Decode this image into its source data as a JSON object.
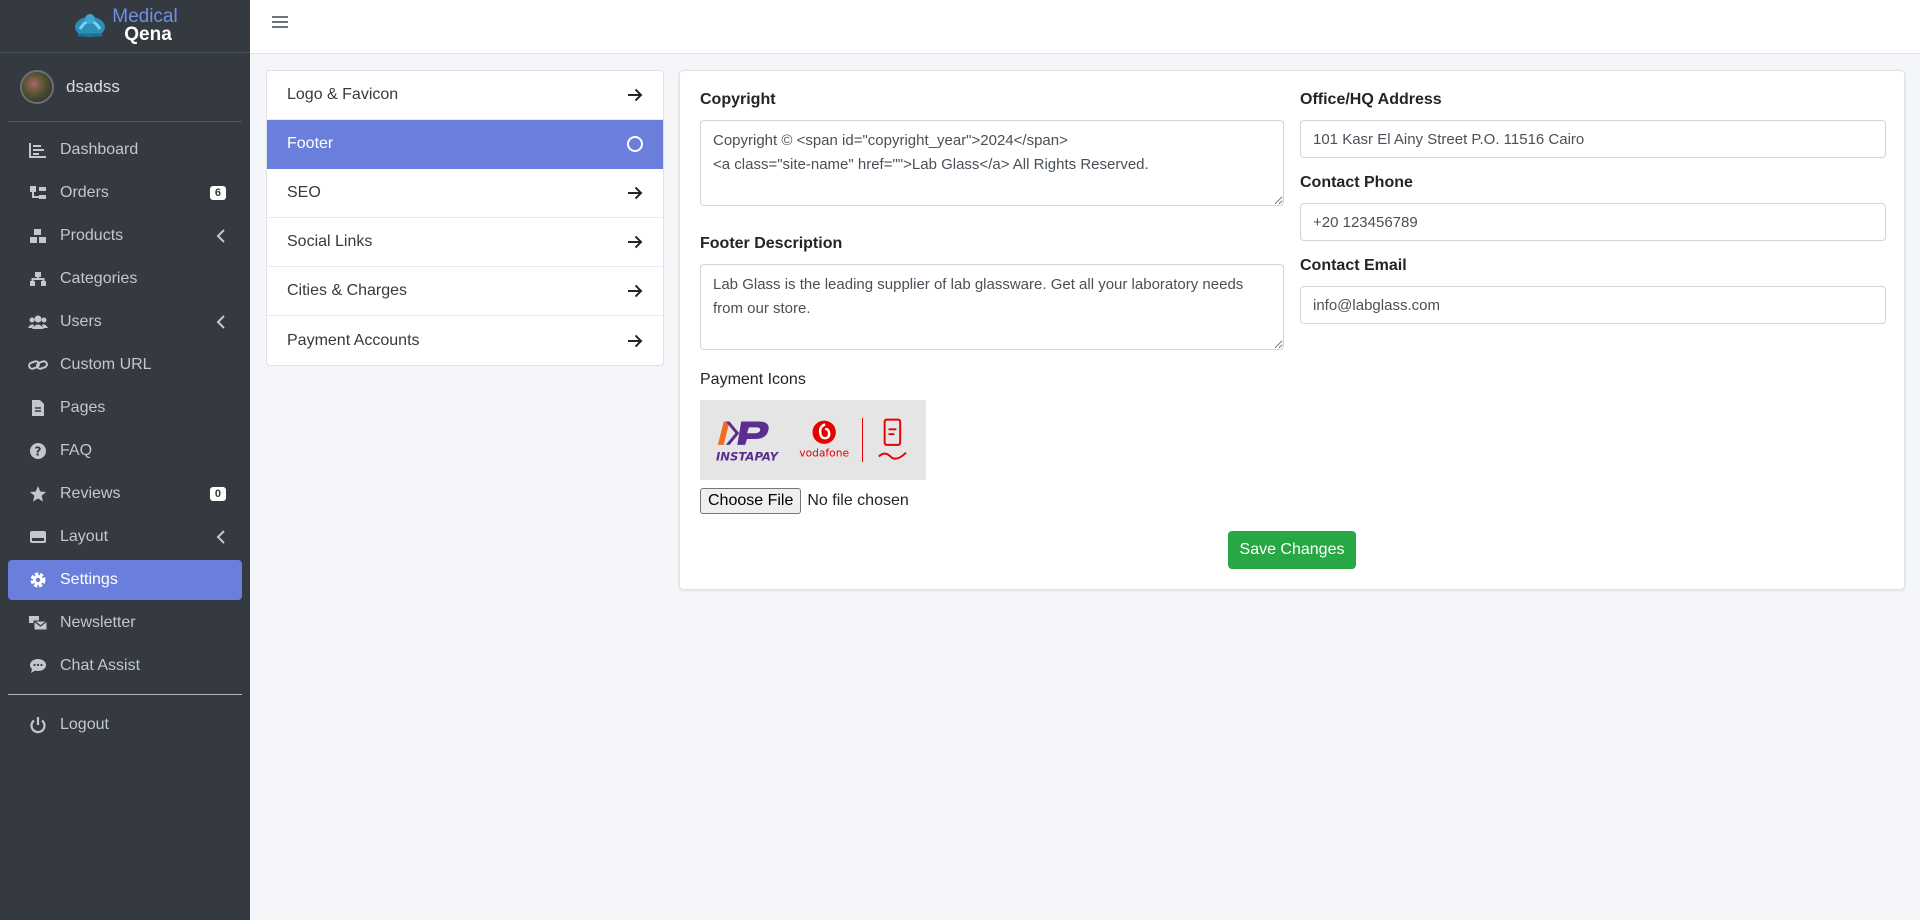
{
  "brand": {
    "line1": "Medical",
    "line2": "Qena"
  },
  "user": {
    "name": "dsadss"
  },
  "sidebar": {
    "items": [
      {
        "label": "Dashboard",
        "icon": "chart-icon"
      },
      {
        "label": "Orders",
        "icon": "orders-icon",
        "badge": "6"
      },
      {
        "label": "Products",
        "icon": "boxes-icon"
      },
      {
        "label": "Categories",
        "icon": "sitemap-icon"
      },
      {
        "label": "Users",
        "icon": "users-icon"
      },
      {
        "label": "Custom URL",
        "icon": "link-icon"
      },
      {
        "label": "Pages",
        "icon": "file-icon"
      },
      {
        "label": "FAQ",
        "icon": "question-icon"
      },
      {
        "label": "Reviews",
        "icon": "star-icon",
        "badge": "0"
      },
      {
        "label": "Layout",
        "icon": "hdd-icon"
      },
      {
        "label": "Settings",
        "icon": "gear-icon"
      },
      {
        "label": "Newsletter",
        "icon": "mail-bulk-icon"
      },
      {
        "label": "Chat Assist",
        "icon": "comment-icon"
      }
    ],
    "logout": "Logout"
  },
  "settings_menu": {
    "items": [
      {
        "label": "Logo & Favicon"
      },
      {
        "label": "Footer"
      },
      {
        "label": "SEO"
      },
      {
        "label": "Social Links"
      },
      {
        "label": "Cities & Charges"
      },
      {
        "label": "Payment Accounts"
      }
    ]
  },
  "form": {
    "copyright_label": "Copyright",
    "copyright_value": "Copyright © <span id=\"copyright_year\">2024</span>\n<a class=\"site-name\" href=\"\">Lab Glass</a> All Rights Reserved.",
    "footer_desc_label": "Footer Description",
    "footer_desc_value": "Lab Glass is the leading supplier of lab glassware. Get all your laboratory needs from our store.",
    "payment_icons_label": "Payment Icons",
    "payment_logos": {
      "instapay": "INSTAPAY",
      "vodafone": "vodafone"
    },
    "file_button": "Choose File",
    "file_status": "No file chosen",
    "address_label": "Office/HQ Address",
    "address_value": "101 Kasr El Ainy Street P.O. 11516 Cairo",
    "phone_label": "Contact Phone",
    "phone_value": "+20 123456789",
    "email_label": "Contact Email",
    "email_value": "info@labglass.com",
    "save_label": "Save Changes"
  },
  "colors": {
    "accent": "#6a7fdb",
    "sidebar_bg": "#343a40",
    "success": "#28a745"
  }
}
